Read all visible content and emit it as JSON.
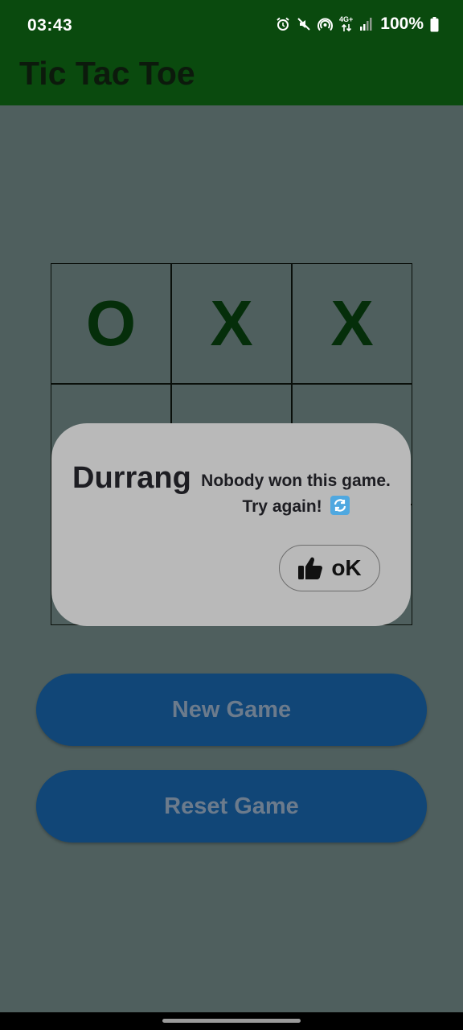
{
  "status_bar": {
    "time": "03:43",
    "network_label": "4G+",
    "battery": "100%",
    "icons": [
      "alarm-icon",
      "mute-icon",
      "hotspot-icon",
      "data-arrows-icon",
      "signal-icon",
      "battery-icon"
    ]
  },
  "app": {
    "title": "Tic Tac Toe"
  },
  "board": {
    "cells": [
      "O",
      "X",
      "X",
      "",
      "",
      "",
      "",
      "",
      ""
    ]
  },
  "buttons": {
    "new_game": "New Game",
    "reset_game": "Reset Game"
  },
  "dialog": {
    "title": "Durrang",
    "message_line1": "Nobody won this game.",
    "message_line2": "Try again!",
    "message_icon": "refresh-emoji-icon",
    "ok_label": "oK",
    "ok_icon": "thumbs-up-icon"
  },
  "colors": {
    "app_bar": "#0a4a0e",
    "scrim_background": "#4f5f5e",
    "button": "#114677",
    "dialog": "#b9b9b9",
    "mark": "#052e0a"
  }
}
